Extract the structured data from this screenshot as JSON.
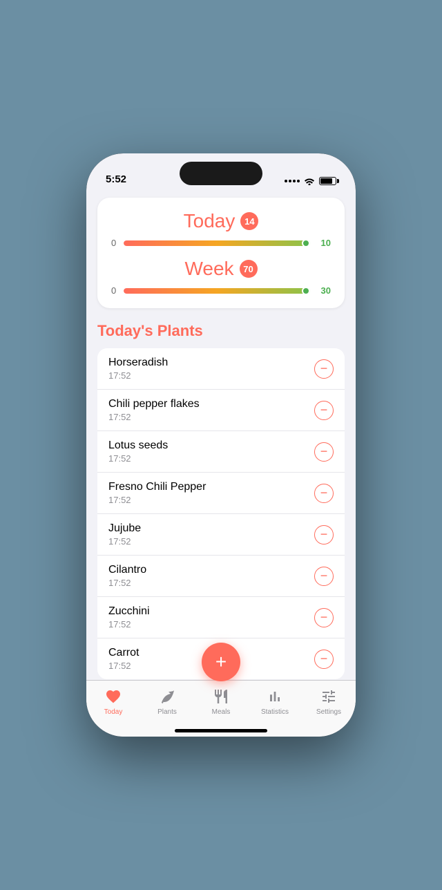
{
  "statusBar": {
    "time": "5:52"
  },
  "progressCard": {
    "today": {
      "label": "Today",
      "badge": "14",
      "minLabel": "0",
      "maxLabel": "10",
      "progressPercent": 100,
      "accentColor": "#ff6b5b"
    },
    "week": {
      "label": "Week",
      "badge": "70",
      "minLabel": "0",
      "maxLabel": "30",
      "progressPercent": 100,
      "accentColor": "#ff6b5b"
    }
  },
  "section": {
    "title": "Today's Plants"
  },
  "plants": [
    {
      "name": "Horseradish",
      "time": "17:52"
    },
    {
      "name": "Chili pepper flakes",
      "time": "17:52"
    },
    {
      "name": "Lotus seeds",
      "time": "17:52"
    },
    {
      "name": "Fresno Chili Pepper",
      "time": "17:52"
    },
    {
      "name": "Jujube",
      "time": "17:52"
    },
    {
      "name": "Cilantro",
      "time": "17:52"
    },
    {
      "name": "Zucchini",
      "time": "17:52"
    },
    {
      "name": "Carrot",
      "time": "17:52"
    }
  ],
  "fab": {
    "label": "+"
  },
  "tabBar": {
    "items": [
      {
        "id": "today",
        "label": "Today",
        "active": true
      },
      {
        "id": "plants",
        "label": "Plants",
        "active": false
      },
      {
        "id": "meals",
        "label": "Meals",
        "active": false
      },
      {
        "id": "statistics",
        "label": "Statistics",
        "active": false
      },
      {
        "id": "settings",
        "label": "Settings",
        "active": false
      }
    ]
  }
}
